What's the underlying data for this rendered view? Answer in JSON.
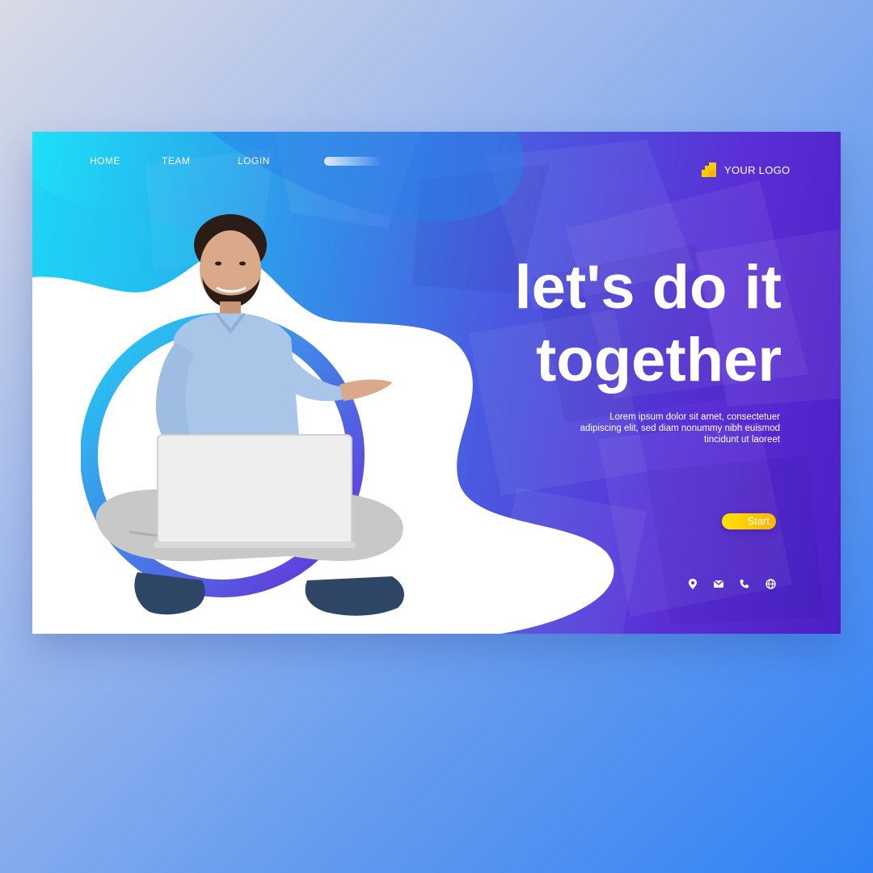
{
  "nav": {
    "items": [
      {
        "label": "HOME"
      },
      {
        "label": "TEAM"
      },
      {
        "label": "LOGIN"
      }
    ]
  },
  "logo": {
    "text": "YOUR LOGO",
    "color": "#ffcc00"
  },
  "hero": {
    "headline_line1": "let's do it",
    "headline_line2": "together",
    "body": "Lorem ipsum dolor sit amet, consectetuer adipiscing elit, sed diam nonummy nibh euismod tincidunt ut laoreet",
    "cta_label": "Start"
  },
  "social": {
    "icons": [
      "location-pin-icon",
      "mail-icon",
      "phone-icon",
      "globe-icon"
    ]
  },
  "colors": {
    "accent": "#ffcc00",
    "gradient_start": "#1ee0f7",
    "gradient_end": "#4b1fc4"
  }
}
